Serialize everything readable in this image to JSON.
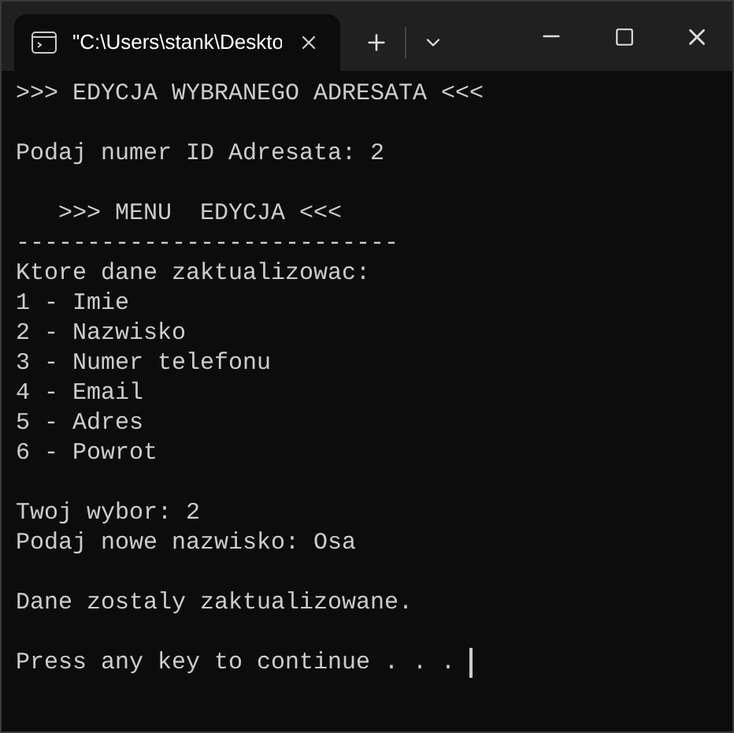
{
  "tab": {
    "title": "\"C:\\Users\\stank\\Deskto"
  },
  "console": {
    "blocks": [
      [
        ">>> EDYCJA WYBRANEGO ADRESATA <<<"
      ],
      [
        "Podaj numer ID Adresata: 2"
      ],
      [
        "   >>> MENU  EDYCJA <<<",
        "---------------------------",
        "Ktore dane zaktualizowac:",
        "1 - Imie",
        "2 - Nazwisko",
        "3 - Numer telefonu",
        "4 - Email",
        "5 - Adres",
        "6 - Powrot"
      ],
      [
        "Twoj wybor: 2",
        "Podaj nowe nazwisko: Osa"
      ],
      [
        "Dane zostaly zaktualizowane."
      ],
      [
        "Press any key to continue . . ."
      ]
    ]
  }
}
